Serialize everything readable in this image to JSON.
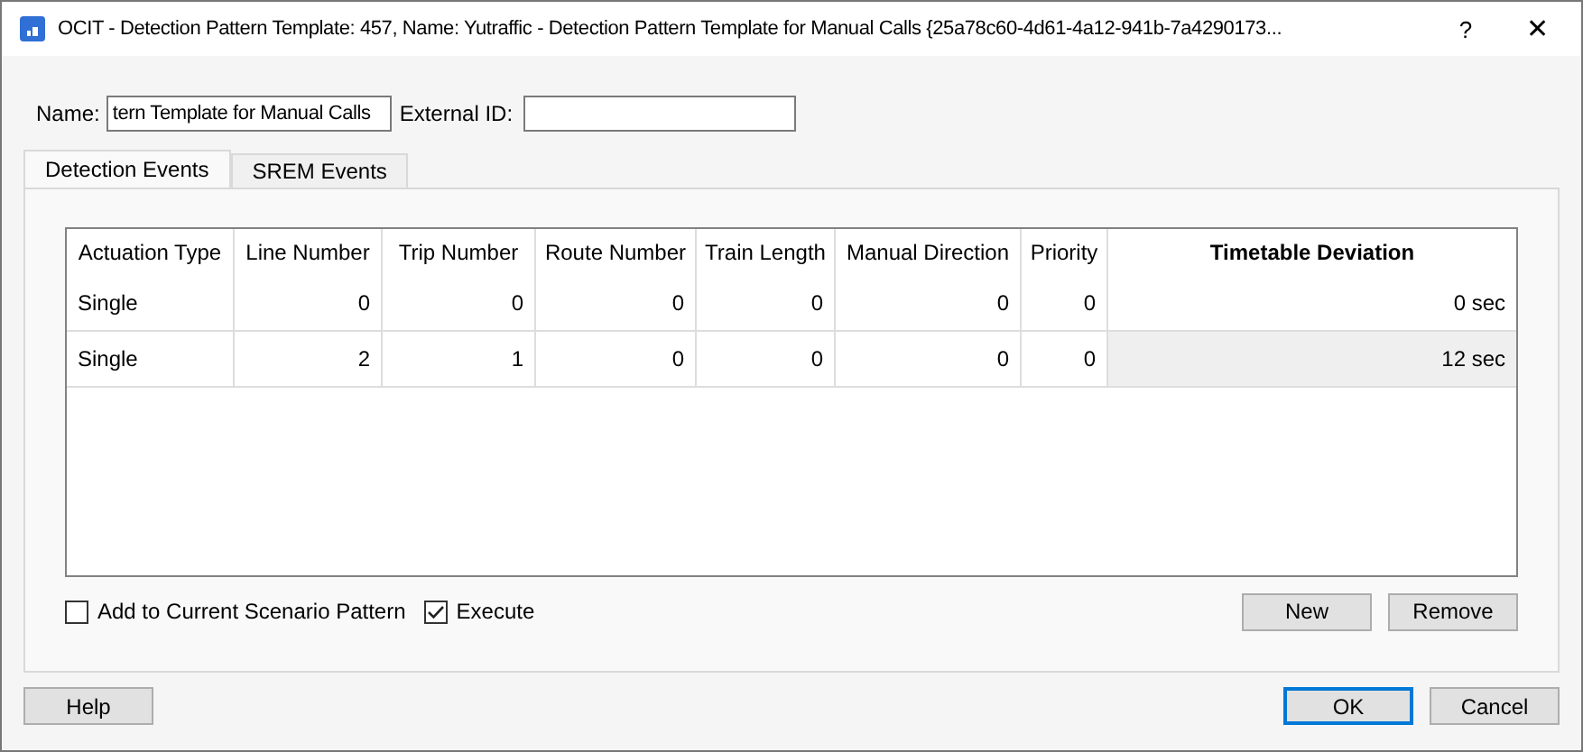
{
  "window": {
    "title": "OCIT - Detection Pattern Template: 457, Name: Yutraffic - Detection Pattern Template for Manual Calls  {25a78c60-4d61-4a12-941b-7a4290173...",
    "help_glyph": "?",
    "close_glyph": "✕"
  },
  "name_field": {
    "label": "Name:",
    "value": "tern Template for Manual Calls"
  },
  "external_id_field": {
    "label": "External ID:"
  },
  "tabs": [
    {
      "label": "Detection Events",
      "selected": true
    },
    {
      "label": "SREM Events",
      "selected": false
    }
  ],
  "table": {
    "columns": [
      {
        "label": "Actuation Type",
        "kind": "text",
        "bold": false
      },
      {
        "label": "Line Number",
        "kind": "number",
        "bold": false
      },
      {
        "label": "Trip Number",
        "kind": "number",
        "bold": false
      },
      {
        "label": "Route Number",
        "kind": "number",
        "bold": false
      },
      {
        "label": "Train Length",
        "kind": "number",
        "bold": false
      },
      {
        "label": "Manual Direction",
        "kind": "number",
        "bold": false
      },
      {
        "label": "Priority",
        "kind": "number",
        "bold": false
      },
      {
        "label": "Timetable Deviation",
        "kind": "number",
        "bold": true
      }
    ],
    "rows": [
      {
        "cells": [
          "Single",
          "0",
          "0",
          "0",
          "0",
          "0",
          "0",
          "0 sec"
        ],
        "selected": false
      },
      {
        "cells": [
          "Single",
          "2",
          "1",
          "0",
          "0",
          "0",
          "0",
          "12 sec"
        ],
        "selected": true
      }
    ]
  },
  "checkboxes": [
    {
      "label": "Add to Current Scenario Pattern",
      "checked": false
    },
    {
      "label": "Execute",
      "checked": true
    }
  ],
  "table_buttons": [
    "New",
    "Remove"
  ],
  "help_button": "Help",
  "dialog_buttons": [
    {
      "label": "OK",
      "default": true
    },
    {
      "label": "Cancel",
      "default": false
    }
  ]
}
